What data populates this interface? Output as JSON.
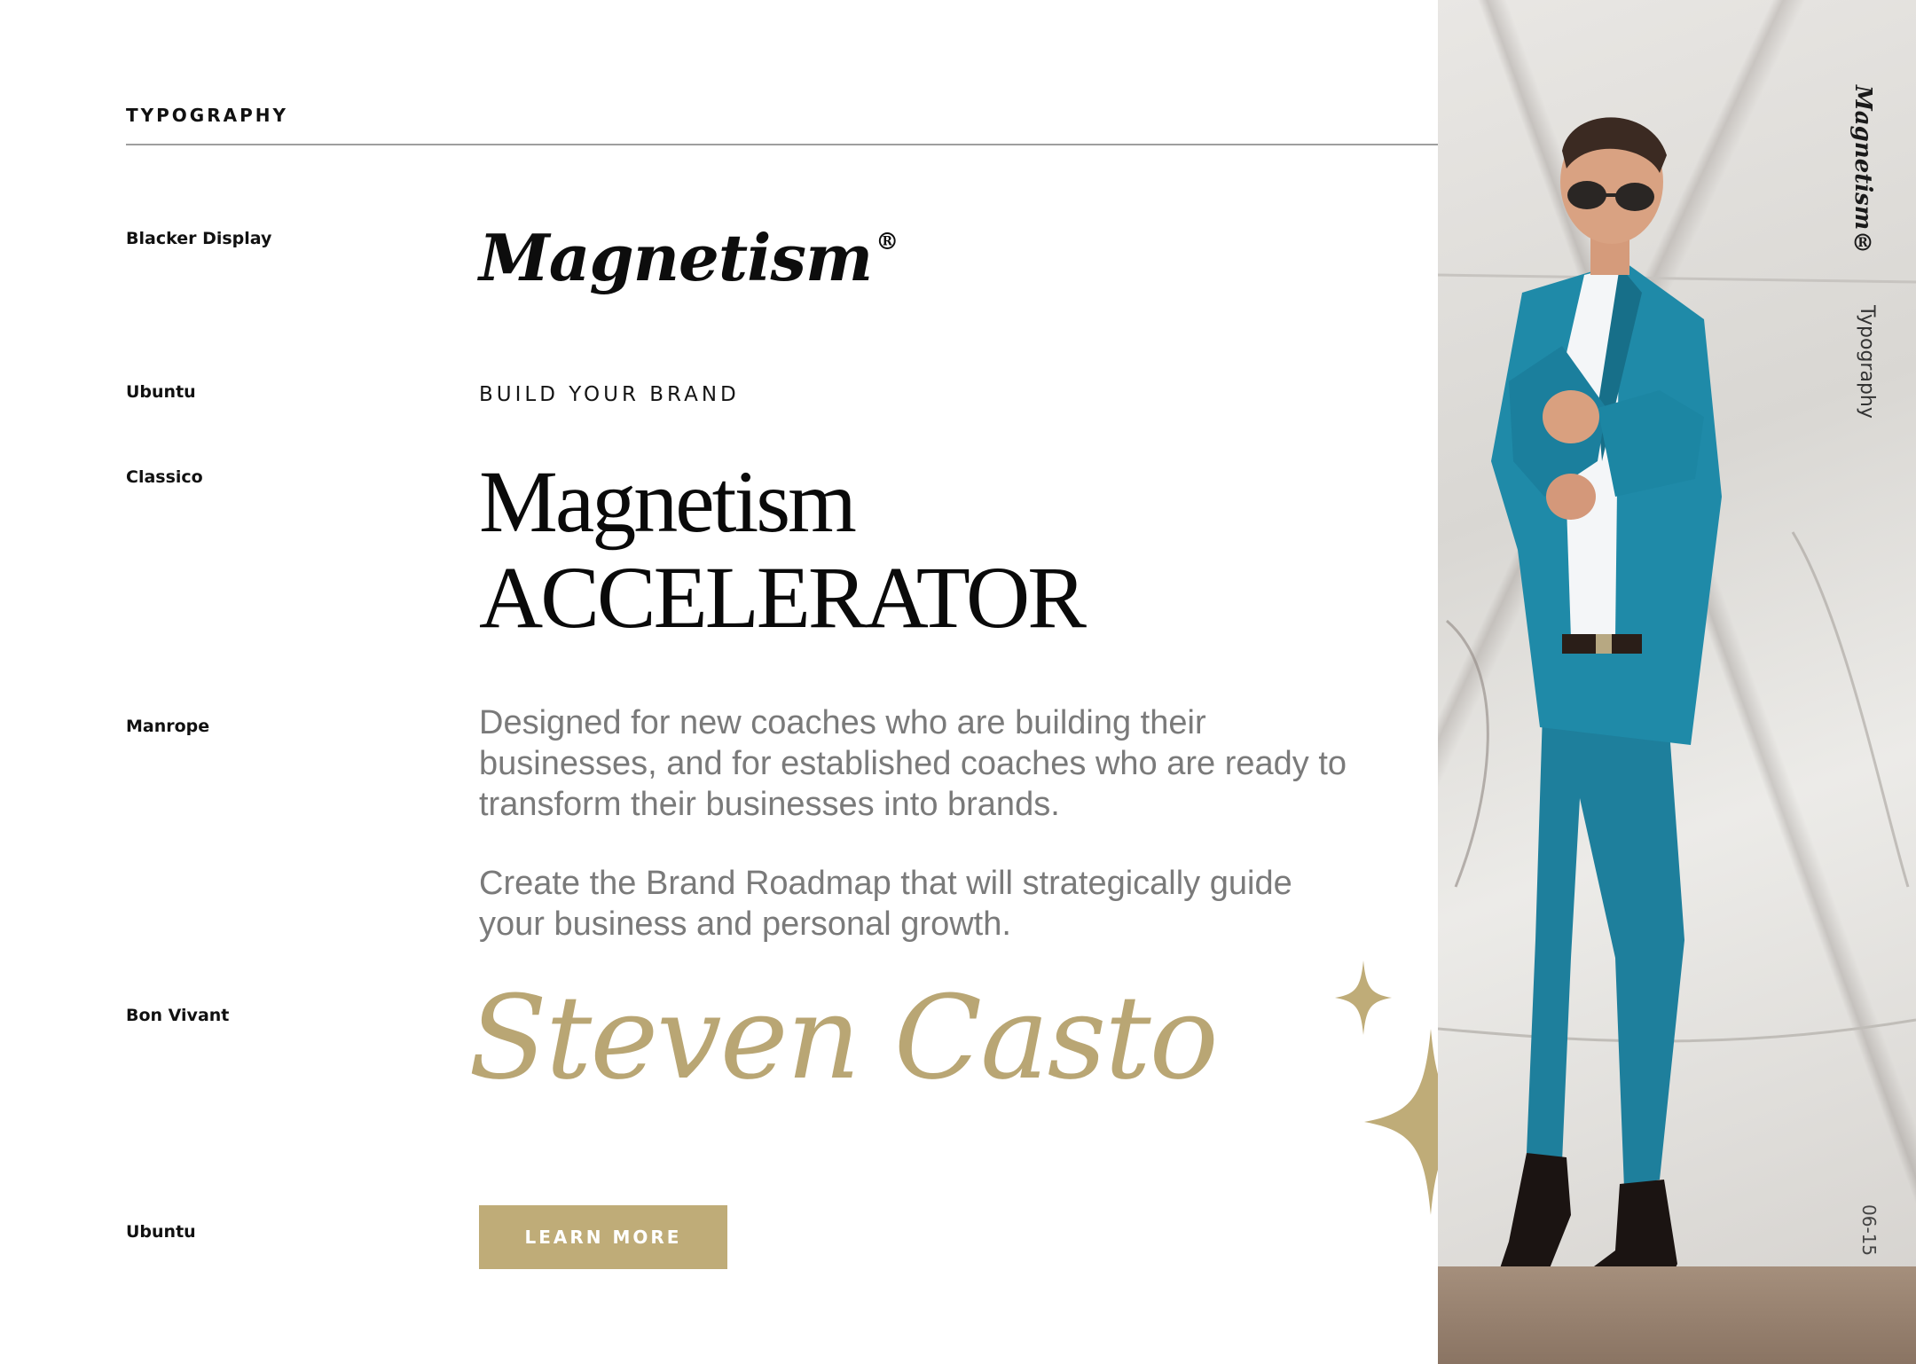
{
  "header": {
    "title": "TYPOGRAPHY"
  },
  "fonts": [
    {
      "label": "Blacker Display"
    },
    {
      "label": "Ubuntu"
    },
    {
      "label": "Classico"
    },
    {
      "label": "Manrope"
    },
    {
      "label": "Bon Vivant"
    },
    {
      "label": "Ubuntu"
    }
  ],
  "samples": {
    "logo_text": "Magnetism",
    "logo_mark": "®",
    "eyebrow": "BUILD YOUR BRAND",
    "headline_line1": "Magnetism",
    "headline_line2": "ACCELERATOR",
    "body_paragraph1": "Designed for new coaches who are building their businesses, and for established coaches who are ready to transform their businesses into brands.",
    "body_paragraph2": "Create the Brand Roadmap that will strategically guide your business and personal growth.",
    "signature": "Steven Casto",
    "button_label": "LEARN MORE"
  },
  "sidebar": {
    "brand": "Magnetism®",
    "section": "Typography",
    "page": "06-15"
  },
  "colors": {
    "accent_gold": "#bfac78",
    "body_gray": "#7a7a7a",
    "suit_teal": "#1e8aa6"
  }
}
